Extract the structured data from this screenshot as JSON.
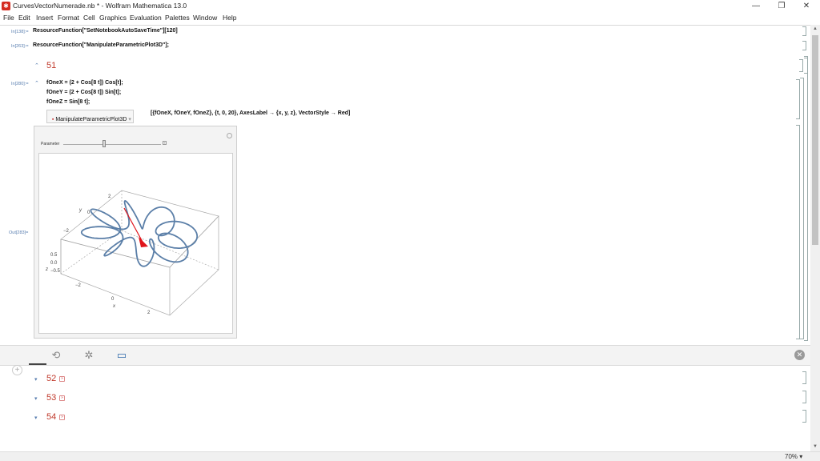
{
  "window": {
    "title": "CurvesVectorNumerade.nb * - Wolfram Mathematica 13.0",
    "minimize": "—",
    "restore": "❐",
    "close": "✕"
  },
  "menu": [
    "File",
    "Edit",
    "Insert",
    "Format",
    "Cell",
    "Graphics",
    "Evaluation",
    "Palettes",
    "Window",
    "Help"
  ],
  "cells": {
    "in138_label": "In[138]:=",
    "in138_code": "ResourceFunction[\"SetNotebookAutoSaveTime\"][120]",
    "in263_label": "In[263]:=",
    "in263_code": "ResourceFunction[\"ManipulateParametricPlot3D\"];",
    "section_51": "51",
    "in280_label": "In[280]:=",
    "code_line1": "fOneX = (2 + Cos[8 t]) Cos[t];",
    "code_line2": "fOneY = (2 + Cos[8 t]) Sin[t];",
    "code_line3": "fOneZ = Sin[8 t];",
    "code_fn": "ManipulateParametricPlot3D",
    "code_args": "[{fOneX, fOneY, fOneZ}, {t, 0, 20}, AxesLabel → {x, y, z}, VectorStyle → Red]",
    "out263_label": "Out[283]=",
    "section_52": "52",
    "section_53": "53",
    "section_54": "54"
  },
  "manipulate": {
    "param_label": "Parameter",
    "slider_value": 0.42,
    "plus": "+"
  },
  "plot": {
    "y_axis_label": "y",
    "z_axis_label": "z",
    "x_axis_label": "x",
    "y_ticks": [
      "2",
      "0",
      "−2"
    ],
    "z_ticks": [
      "0.5",
      "0.0",
      "−0.5"
    ],
    "x_ticks": [
      "−2",
      "0",
      "2"
    ],
    "curve_color": "#5b7fa8",
    "vector_color": "#e0141b"
  },
  "status": {
    "zoom": "70%"
  }
}
